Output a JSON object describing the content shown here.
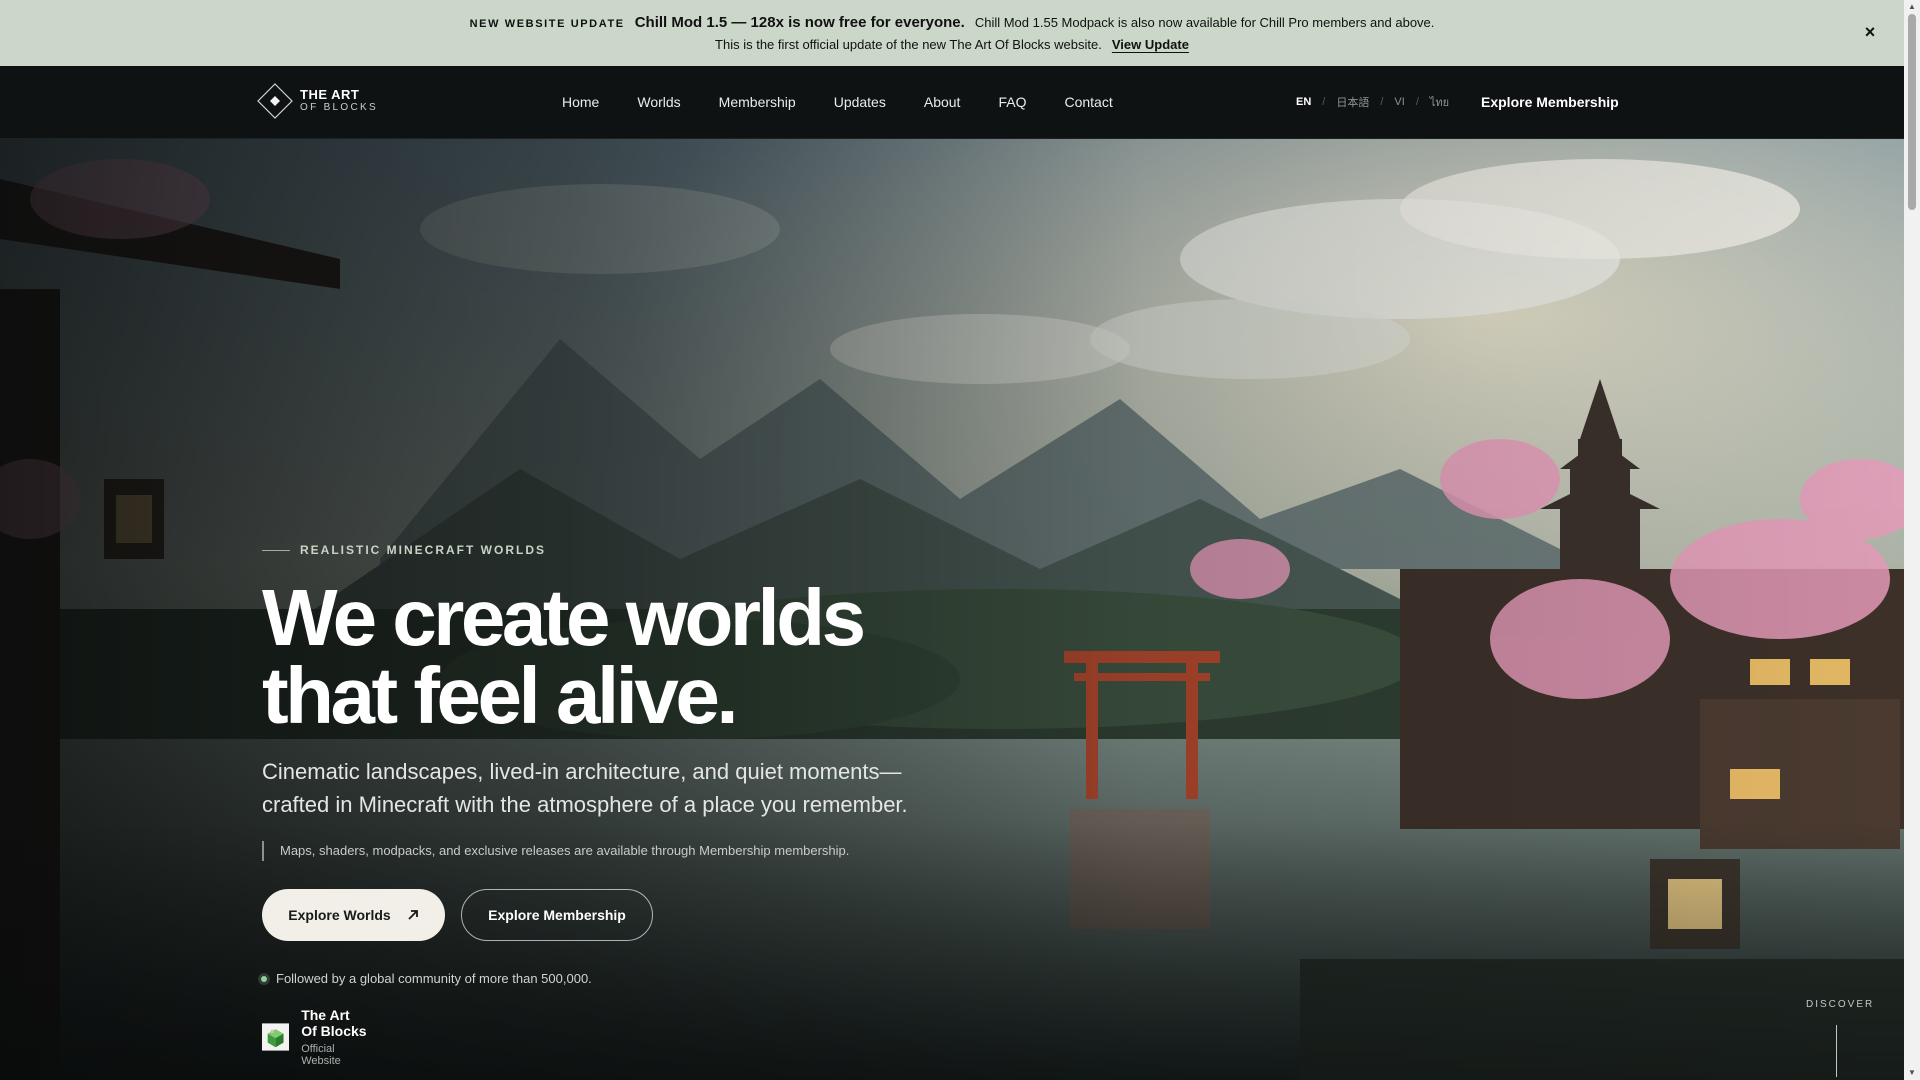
{
  "announcement": {
    "tag": "NEW WEBSITE UPDATE",
    "headline": "Chill Mod 1.5 — 128x is now free for everyone.",
    "detail": "Chill Mod 1.55 Modpack is also now available for Chill Pro members and above.",
    "line2": "This is the first official update of the new The Art Of Blocks website.",
    "link": "View Update",
    "close_icon": "close-icon"
  },
  "nav": {
    "logo_line1": "THE ART",
    "logo_line2": "OF BLOCKS",
    "items": [
      "Home",
      "Worlds",
      "Membership",
      "Updates",
      "About",
      "FAQ",
      "Contact"
    ],
    "languages": [
      "EN",
      "日本語",
      "VI",
      "ไทย"
    ],
    "active_language": "EN",
    "cta": "Explore Membership"
  },
  "hero": {
    "eyebrow": "REALISTIC MINECRAFT WORLDS",
    "title_line1": "We create worlds",
    "title_line2": "that feel alive.",
    "subtitle_line1": "Cinematic landscapes, lived-in architecture, and quiet moments—",
    "subtitle_line2": "crafted in Minecraft with the atmosphere of a place you remember.",
    "note": "Maps, shaders, modpacks, and exclusive releases are available through Membership membership.",
    "primary_button": "Explore Worlds",
    "secondary_button": "Explore Membership",
    "community": "Followed by a global community of more than 500,000.",
    "badge_title": "The Art Of Blocks",
    "badge_subtitle": "Official Website",
    "discover": "DISCOVER"
  },
  "colors": {
    "announcement_bg": "#cbd8c9",
    "nav_bg": "#0e1212",
    "eyebrow": "#c7d4c4",
    "primary_button_bg": "#f1efe8",
    "online_dot": "#8fd39b"
  }
}
